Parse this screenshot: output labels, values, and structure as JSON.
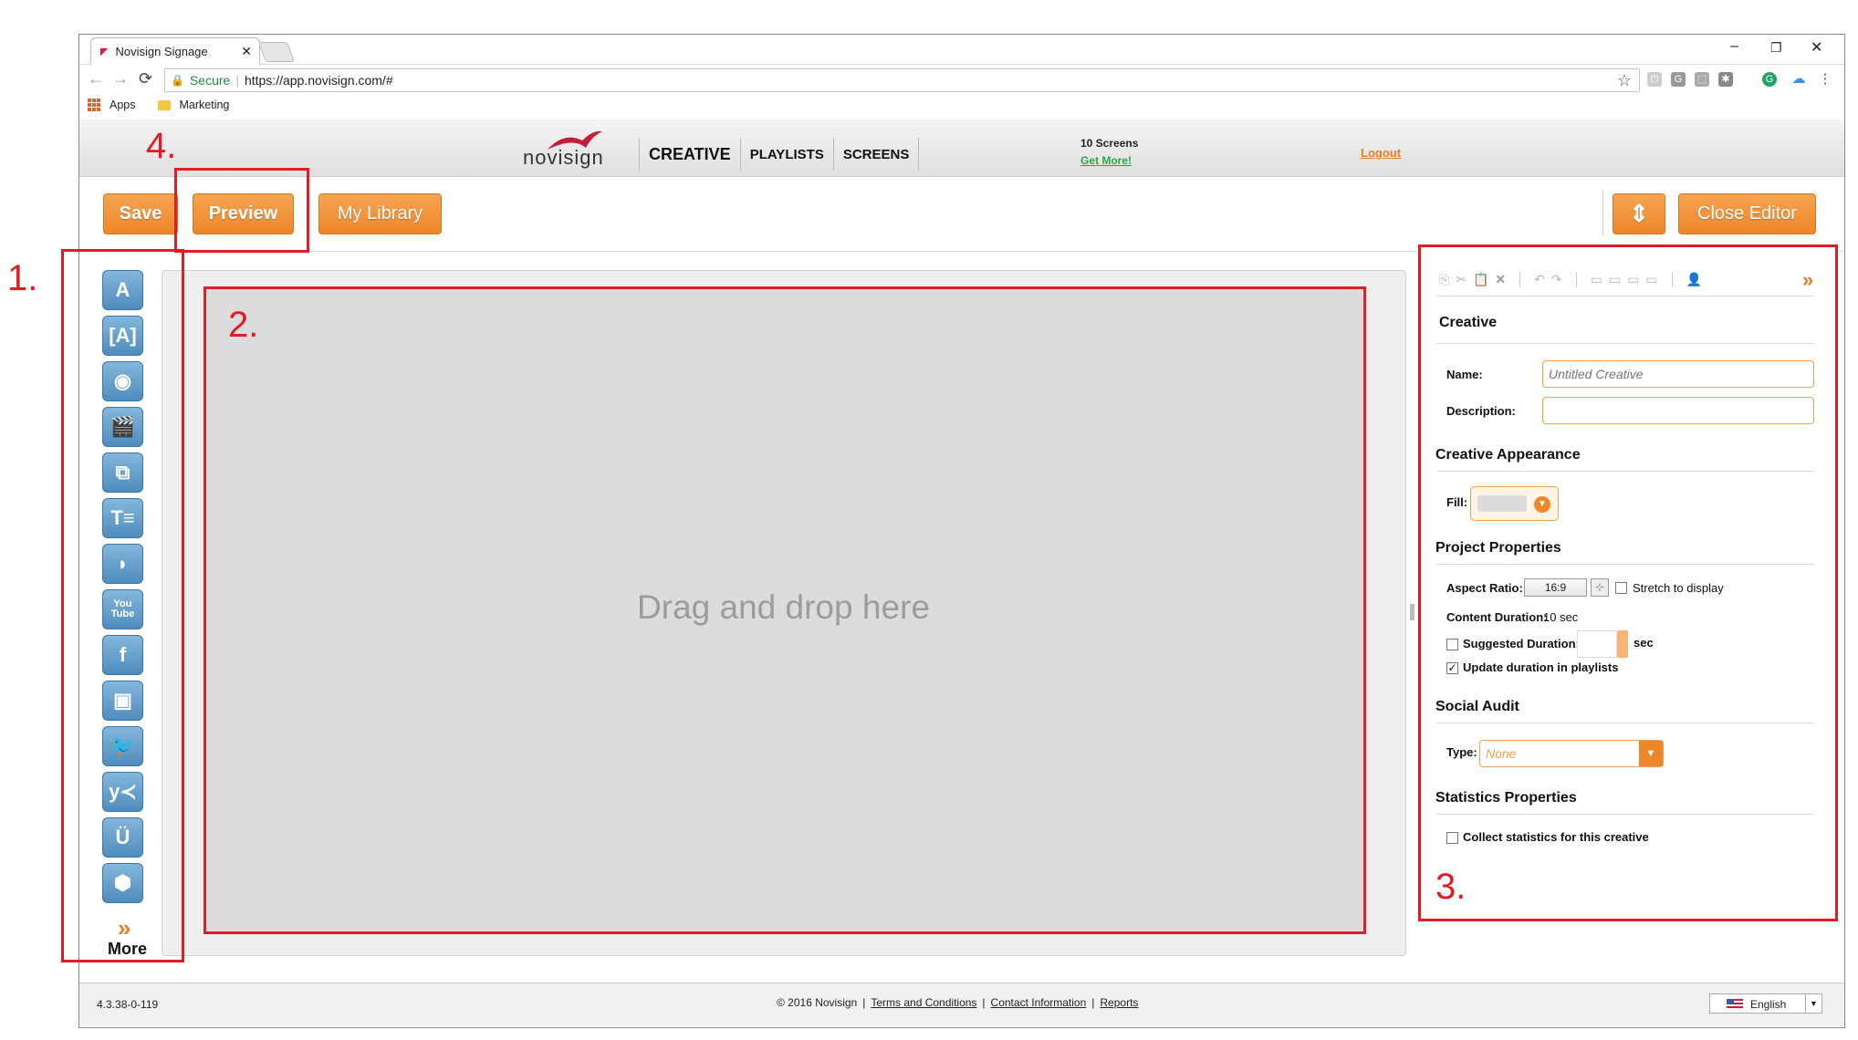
{
  "browser": {
    "tab_title": "Novisign Signage",
    "secure_label": "Secure",
    "url": "https://app.novisign.com/#",
    "bookmarks": [
      "Apps",
      "Marketing"
    ]
  },
  "header": {
    "logo_text": "novisign",
    "nav": [
      "CREATIVE",
      "PLAYLISTS",
      "SCREENS"
    ],
    "screens_count": "10 Screens",
    "get_more": "Get More!",
    "logout": "Logout"
  },
  "toolbar": {
    "save": "Save",
    "preview": "Preview",
    "library": "My Library",
    "resize_icon": "⇕",
    "close_editor": "Close Editor"
  },
  "tools": {
    "items": [
      "text-tool-icon",
      "text-box-tool-icon",
      "image-tool-icon",
      "video-tool-icon",
      "slideshow-tool-icon",
      "rich-text-tool-icon",
      "rss-tool-icon",
      "youtube-tool-icon",
      "facebook-tool-icon",
      "instagram-tool-icon",
      "twitter-tool-icon",
      "yammer-tool-icon",
      "ustream-tool-icon",
      "widget-tool-icon"
    ],
    "glyphs": [
      "A",
      "[A]",
      "◉",
      "🎬",
      "⧉",
      "T≡",
      "◗",
      "You Tube",
      "f",
      "▣",
      "🐦",
      "y≺",
      "Ü",
      "⬢"
    ],
    "more": "More",
    "more_arrow": "»"
  },
  "canvas": {
    "drop_text": "Drag and drop here"
  },
  "properties": {
    "collapse_icon": "»",
    "creative_title": "Creative",
    "name_label": "Name:",
    "name_placeholder": "Untitled Creative",
    "description_label": "Description:",
    "description_value": "",
    "appearance_title": "Creative Appearance",
    "fill_label": "Fill:",
    "fill_color": "#dcdcdc",
    "project_title": "Project Properties",
    "aspect_label": "Aspect Ratio:",
    "aspect_value": "16:9",
    "stretch_label": "Stretch to display",
    "stretch_checked": false,
    "content_duration_label": "Content Duration:",
    "content_duration_value": "10 sec",
    "suggested_label": "Suggested Duration:",
    "suggested_checked": false,
    "suggested_unit": "sec",
    "update_label": "Update duration in playlists",
    "update_checked": true,
    "social_title": "Social Audit",
    "type_label": "Type:",
    "type_value": "None",
    "stats_title": "Statistics Properties",
    "stats_label": "Collect statistics for this creative",
    "stats_checked": false
  },
  "footer": {
    "version": "4.3.38-0-119",
    "copyright": "© 2016 Novisign",
    "links": [
      "Terms and Conditions",
      "Contact Information",
      "Reports"
    ],
    "language": "English"
  },
  "annotations": {
    "labels": [
      "1.",
      "2.",
      "3.",
      "4."
    ]
  },
  "colors": {
    "accent": "#ee862a",
    "annotation": "#e01d25",
    "tool_blue": "#4f8cbd",
    "link_green": "#28a745"
  }
}
